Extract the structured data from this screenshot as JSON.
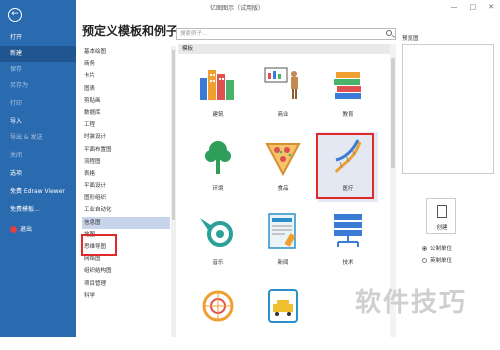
{
  "window": {
    "title": "亿图图示（试用版）",
    "min": "—",
    "max": "□",
    "close": "✕"
  },
  "backstage": {
    "items": [
      {
        "label": "打开",
        "state": "normal"
      },
      {
        "label": "新建",
        "state": "active"
      },
      {
        "label": "保存",
        "state": "dim"
      },
      {
        "label": "另存为",
        "state": "dim"
      },
      {
        "label": "打印",
        "state": "dim"
      },
      {
        "label": "导入",
        "state": "normal"
      },
      {
        "label": "导出 & 发送",
        "state": "dim"
      },
      {
        "label": "关闭",
        "state": "dim"
      },
      {
        "label": "选项",
        "state": "normal"
      },
      {
        "label": "免费 Edraw Viewer",
        "state": "normal"
      },
      {
        "label": "免费模板...",
        "state": "normal"
      },
      {
        "label": "退出",
        "state": "normal"
      }
    ]
  },
  "heading": "预定义模板和例子",
  "search": {
    "placeholder": "搜索例子..."
  },
  "categories": [
    "基本绘图",
    "商务",
    "卡片",
    "图表",
    "剪贴画",
    "数据库",
    "工程",
    "时装设计",
    "平面布置图",
    "流程图",
    "表格",
    "平面设计",
    "图形组织",
    "工业自动化",
    "信息图",
    "地图",
    "思维导图",
    "网络图",
    "组织结构图",
    "项目管理",
    "科学"
  ],
  "selected_category": "信息图",
  "templates": {
    "header": "模板",
    "tiles": [
      "建筑",
      "商业",
      "教育",
      "环境",
      "食品",
      "医疗",
      "音乐",
      "新闻",
      "技术",
      "",
      ""
    ]
  },
  "preview": {
    "label": "预览图",
    "create": "创建"
  },
  "units": [
    "公制单位",
    "英制单位"
  ],
  "watermark": "软件技巧",
  "colors": {
    "backstage": "#2a6aae",
    "highlight": "#e02a2a",
    "selection": "#c8d4ea"
  }
}
